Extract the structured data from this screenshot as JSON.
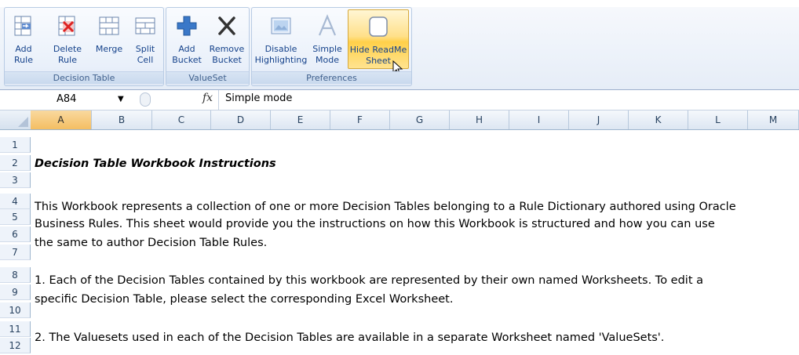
{
  "ribbon": {
    "groups": [
      {
        "label": "Decision Table",
        "buttons": [
          {
            "label": "Add\nRule",
            "icon": "add-rule-icon"
          },
          {
            "label": "Delete\nRule",
            "icon": "delete-rule-icon"
          },
          {
            "label": "Merge",
            "icon": "merge-icon"
          },
          {
            "label": "Split\nCell",
            "icon": "split-cell-icon"
          }
        ]
      },
      {
        "label": "ValueSet",
        "buttons": [
          {
            "label": "Add\nBucket",
            "icon": "add-bucket-icon"
          },
          {
            "label": "Remove\nBucket",
            "icon": "remove-bucket-icon"
          }
        ]
      },
      {
        "label": "Preferences",
        "buttons": [
          {
            "label": "Disable\nHighlighting",
            "icon": "highlighting-icon"
          },
          {
            "label": "Simple\nMode",
            "icon": "simple-mode-icon"
          },
          {
            "label": "Hide ReadMe\nSheet",
            "icon": "hide-readme-icon",
            "active": true
          }
        ]
      }
    ]
  },
  "formula_bar": {
    "name_box": "A84",
    "fx_label": "fx",
    "content": "Simple mode"
  },
  "grid": {
    "columns": [
      "A",
      "B",
      "C",
      "D",
      "E",
      "F",
      "G",
      "H",
      "I",
      "J",
      "K",
      "L",
      "M"
    ],
    "selected_column": "A",
    "rows": [
      "1",
      "2",
      "3",
      "4",
      "5",
      "6",
      "7",
      "8",
      "9",
      "10",
      "11",
      "12"
    ]
  },
  "sheet": {
    "title": "Decision Table Workbook Instructions",
    "para1_line1": "This Workbook represents a collection of one or more Decision Tables belonging to a Rule Dictionary authored using Oracle",
    "para1_line2": "Business Rules. This sheet would provide you the instructions on how this Workbook is structured and how you can use",
    "para1_line3": "the same to author Decision Table Rules.",
    "para2_line1": " 1. Each of the Decision Tables contained by this workbook are represented by their own named Worksheets.  To edit a",
    "para2_line2": "specific Decision Table, please select the corresponding Excel Worksheet.",
    "para3_line1": " 2. The Valuesets used in each of the Decision Tables are available in a separate Worksheet named 'ValueSets'."
  },
  "colors": {
    "ribbon_text": "#15428b",
    "group_label": "#3e5f8c",
    "active_button": "#ffd04a",
    "header_bg": "#dde6f2"
  }
}
